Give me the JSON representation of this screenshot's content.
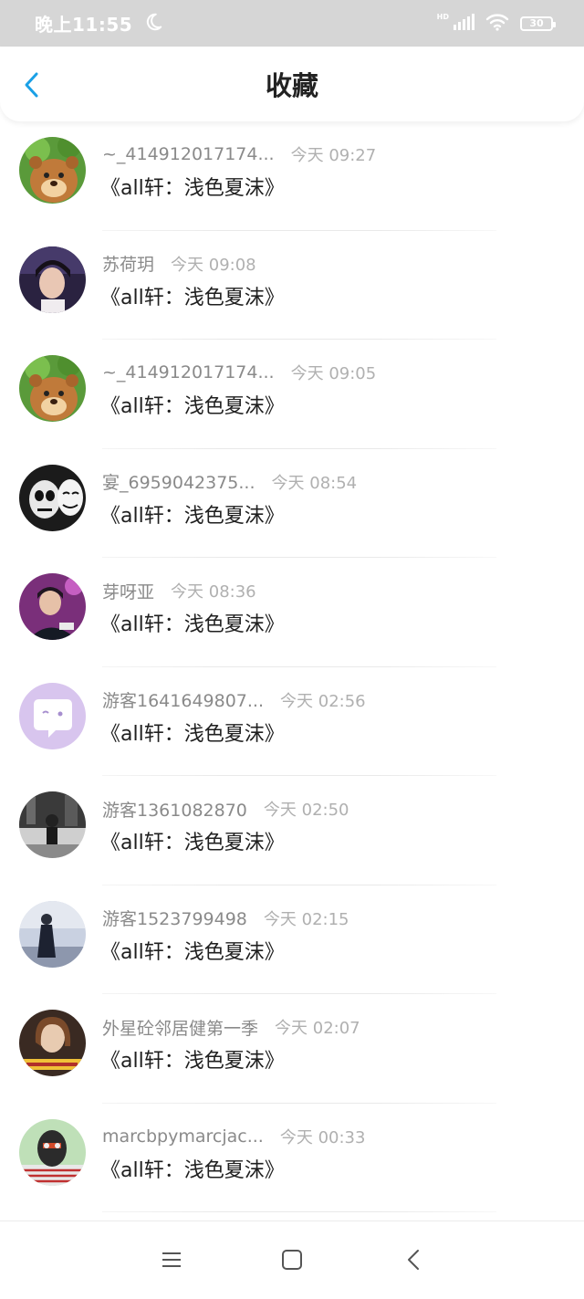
{
  "status_bar": {
    "time": "晚上11:55",
    "network_label": "HD",
    "battery_level": "30",
    "icons": [
      "moon-icon",
      "signal-icon",
      "wifi-icon",
      "battery-icon"
    ]
  },
  "header": {
    "title": "收藏",
    "back_icon": "chevron-left-icon",
    "accent_color": "#1aa0e6"
  },
  "items": [
    {
      "username": "~_414912017174...",
      "time": "今天 09:27",
      "title": "《all轩：浅色夏沫》",
      "avatar": "bear"
    },
    {
      "username": "苏荷玥",
      "time": "今天 09:08",
      "title": "《all轩：浅色夏沫》",
      "avatar": "photo-dark"
    },
    {
      "username": "~_414912017174...",
      "time": "今天 09:05",
      "title": "《all轩：浅色夏沫》",
      "avatar": "bear"
    },
    {
      "username": "宴_6959042375...",
      "time": "今天 08:54",
      "title": "《all轩：浅色夏沫》",
      "avatar": "mask"
    },
    {
      "username": "芽呀亚",
      "time": "今天 08:36",
      "title": "《all轩：浅色夏沫》",
      "avatar": "photo-purple"
    },
    {
      "username": "游客1641649807...",
      "time": "今天 02:56",
      "title": "《all轩：浅色夏沫》",
      "avatar": "default"
    },
    {
      "username": "游客1361082870",
      "time": "今天 02:50",
      "title": "《all轩：浅色夏沫》",
      "avatar": "photo-bw"
    },
    {
      "username": "游客1523799498",
      "time": "今天 02:15",
      "title": "《all轩：浅色夏沫》",
      "avatar": "photo-light"
    },
    {
      "username": "外星砼邻居健第一季",
      "time": "今天 02:07",
      "title": "《all轩：浅色夏沫》",
      "avatar": "photo-warm"
    },
    {
      "username": "marcbpymarcjac...",
      "time": "今天 00:33",
      "title": "《all轩：浅色夏沫》",
      "avatar": "photo-green"
    }
  ],
  "nav_bar": {
    "icons": [
      "menu-icon",
      "home-icon",
      "back-icon"
    ]
  }
}
